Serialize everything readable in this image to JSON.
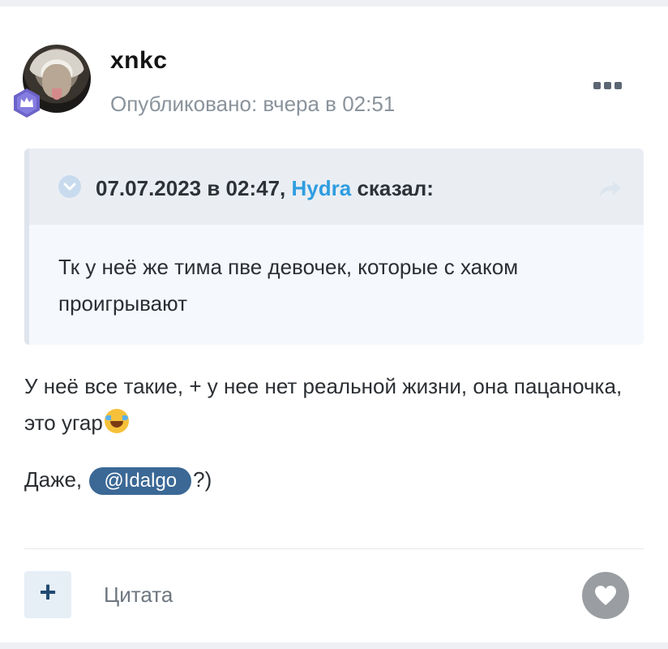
{
  "post": {
    "author": "xnkc",
    "posted_label": "Опубликовано: вчера в 02:51",
    "more_icon": "ellipsis-icon",
    "badge_icon": "crown-badge-icon"
  },
  "quote": {
    "date": "07.07.2023 в 02:47,",
    "quoted_user": "Hydra",
    "said": "сказал:",
    "text": "Тк у неё же тима пве девочек, которые с хаком проигрывают",
    "collapse_icon": "chevron-down-icon",
    "jump_icon": "share-arrow-icon"
  },
  "body": {
    "paragraph1": "У неё все такие, + у нее нет реальной жизни, она пацаночка, это угар",
    "emoji_name": "tears-of-joy-emoji",
    "line2_prefix": "Даже,",
    "mention": "@Idalgo",
    "line2_suffix": "?)"
  },
  "footer": {
    "plus_label": "+",
    "cite_label": "Цитата",
    "like_icon": "heart-icon"
  },
  "colors": {
    "accent_link": "#2f9de0",
    "mention_bg": "#3b6895",
    "like_bg": "#9a9da1"
  }
}
